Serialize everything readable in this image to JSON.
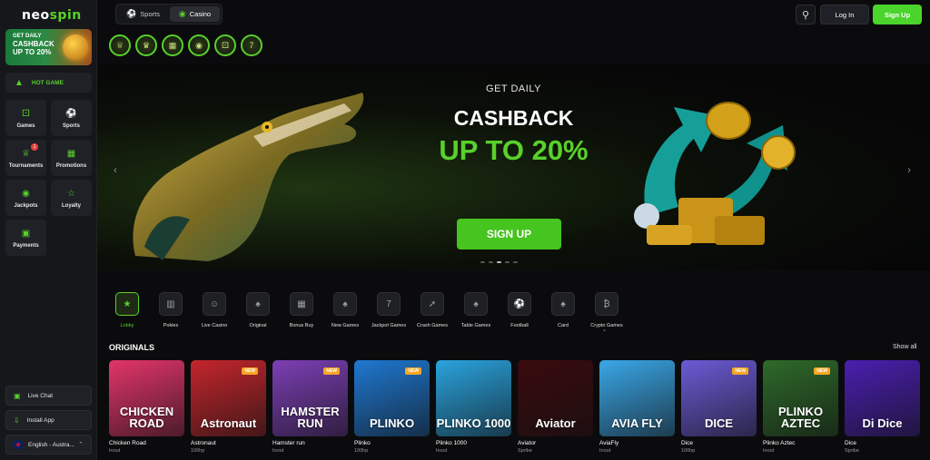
{
  "brand": {
    "logo_a": "neo",
    "logo_b": "spin",
    "accent": "#59d12b"
  },
  "sidebar": {
    "promo": {
      "line1": "GET DAILY",
      "line2": "CASHBACK",
      "line3": "UP TO 20%"
    },
    "hot_game": "HOT GAME",
    "nav": [
      {
        "label": "Games",
        "icon": "dice-icon"
      },
      {
        "label": "Sports",
        "icon": "ball-icon"
      },
      {
        "label": "Tournaments",
        "icon": "trophy-icon",
        "badge": "1"
      },
      {
        "label": "Promotions",
        "icon": "gift-icon"
      },
      {
        "label": "Jackpots",
        "icon": "moneybag-icon"
      },
      {
        "label": "Loyalty",
        "icon": "star-icon"
      },
      {
        "label": "Payments",
        "icon": "wallet-icon"
      }
    ],
    "live_chat": "Live Chat",
    "install_app": "Install App",
    "language": "English - Austra..."
  },
  "header": {
    "tabs": [
      {
        "label": "Sports"
      },
      {
        "label": "Casino",
        "active": true
      }
    ],
    "login": "Log In",
    "signup": "Sign Up"
  },
  "banner": {
    "line1": "GET DAILY",
    "line2": "CASHBACK",
    "line3": "UP TO 20%",
    "cta": "SIGN UP",
    "slides": 5,
    "active_slide": 2
  },
  "categories": [
    {
      "label": "Lobby",
      "active": true,
      "icon": "lobby-icon"
    },
    {
      "label": "Pokies",
      "icon": "slot-icon"
    },
    {
      "label": "Live Casino",
      "icon": "dealer-icon"
    },
    {
      "label": "Original",
      "icon": "cards-icon"
    },
    {
      "label": "Bonus Buy",
      "icon": "gift-icon"
    },
    {
      "label": "New Games",
      "icon": "cards-icon"
    },
    {
      "label": "Jackpot Games",
      "icon": "777-icon"
    },
    {
      "label": "Crash Games",
      "icon": "rocket-icon"
    },
    {
      "label": "Table Games",
      "icon": "cards-icon"
    },
    {
      "label": "Football",
      "icon": "football-icon"
    },
    {
      "label": "Card",
      "icon": "cards-icon"
    },
    {
      "label": "Crypto Games",
      "icon": "bitcoin-icon"
    }
  ],
  "originals": {
    "title": "ORIGINALS",
    "show_all": "Show all",
    "games": [
      {
        "name": "Chicken Road",
        "provider": "Inout",
        "art": "CHICKEN ROAD",
        "bg": "#e3356a",
        "new": false
      },
      {
        "name": "Astronaut",
        "provider": "100hp",
        "art": "Astronaut",
        "bg": "#c3262c",
        "new": true
      },
      {
        "name": "Hamster run",
        "provider": "Inout",
        "art": "HAMSTER RUN",
        "bg": "#7c3fb5",
        "new": true
      },
      {
        "name": "Plinko",
        "provider": "100hp",
        "art": "PLINKO",
        "bg": "#1f78d1",
        "new": true
      },
      {
        "name": "Plinko 1000",
        "provider": "Inout",
        "art": "PLINKO 1000",
        "bg": "#2aa3de",
        "new": false
      },
      {
        "name": "Aviator",
        "provider": "Spribe",
        "art": "Aviator",
        "bg": "#3a0a0e",
        "new": false
      },
      {
        "name": "AviaFly",
        "provider": "Inout",
        "art": "AVIA FLY",
        "bg": "#3aa7e8",
        "new": false
      },
      {
        "name": "Dice",
        "provider": "100hp",
        "art": "DICE",
        "bg": "#6b5bd6",
        "new": true
      },
      {
        "name": "Plinko Aztec",
        "provider": "Inout",
        "art": "PLINKO AZTEC",
        "bg": "#2e6a2a",
        "new": true
      },
      {
        "name": "Dice",
        "provider": "Spribe",
        "art": "Di Dice",
        "bg": "#4a1fb0",
        "new": false
      }
    ]
  }
}
